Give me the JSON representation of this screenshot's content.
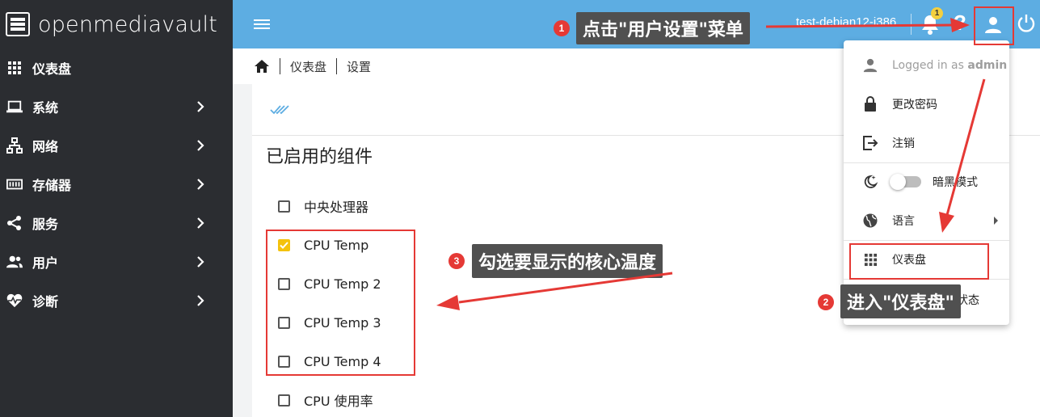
{
  "app": {
    "brand": "openmediavault"
  },
  "sidebar": {
    "items": [
      {
        "label": "仪表盘",
        "icon": "grid-icon",
        "has_children": false
      },
      {
        "label": "系统",
        "icon": "laptop-icon",
        "has_children": true
      },
      {
        "label": "网络",
        "icon": "network-icon",
        "has_children": true
      },
      {
        "label": "存储器",
        "icon": "storage-icon",
        "has_children": true
      },
      {
        "label": "服务",
        "icon": "share-icon",
        "has_children": true
      },
      {
        "label": "用户",
        "icon": "users-icon",
        "has_children": true
      },
      {
        "label": "诊断",
        "icon": "heartbeat-icon",
        "has_children": true
      }
    ]
  },
  "header": {
    "hostname": "test-debian12-i386",
    "notification_count": "1",
    "help_label": "?"
  },
  "breadcrumb": {
    "items": [
      "仪表盘",
      "设置"
    ]
  },
  "main": {
    "section_title": "已启用的组件",
    "options": [
      {
        "label": "中央处理器",
        "checked": false
      },
      {
        "label": "CPU Temp",
        "checked": true
      },
      {
        "label": "CPU Temp 2",
        "checked": false
      },
      {
        "label": "CPU Temp 3",
        "checked": false
      },
      {
        "label": "CPU Temp 4",
        "checked": false
      },
      {
        "label": "CPU 使用率",
        "checked": false
      }
    ]
  },
  "user_menu": {
    "logged_in_prefix": "Logged in as ",
    "logged_in_user": "admin",
    "change_password": "更改密码",
    "logout": "注销",
    "dark_mode": "暗黑模式",
    "language": "语言",
    "dashboard": "仪表盘",
    "system_status": "状态"
  },
  "annotations": {
    "step1": {
      "number": "1",
      "text": "点击\"用户设置\"菜单"
    },
    "step2": {
      "number": "2",
      "text": "进入\"仪表盘\""
    },
    "step3": {
      "number": "3",
      "text": "勾选要显示的核心温度"
    }
  },
  "colors": {
    "sidebar_bg": "#2b2d31",
    "header_bg": "#5dade2",
    "checkbox_checked": "#f4c20d",
    "annotation_red": "#e53935",
    "annotation_bg": "#505050"
  }
}
